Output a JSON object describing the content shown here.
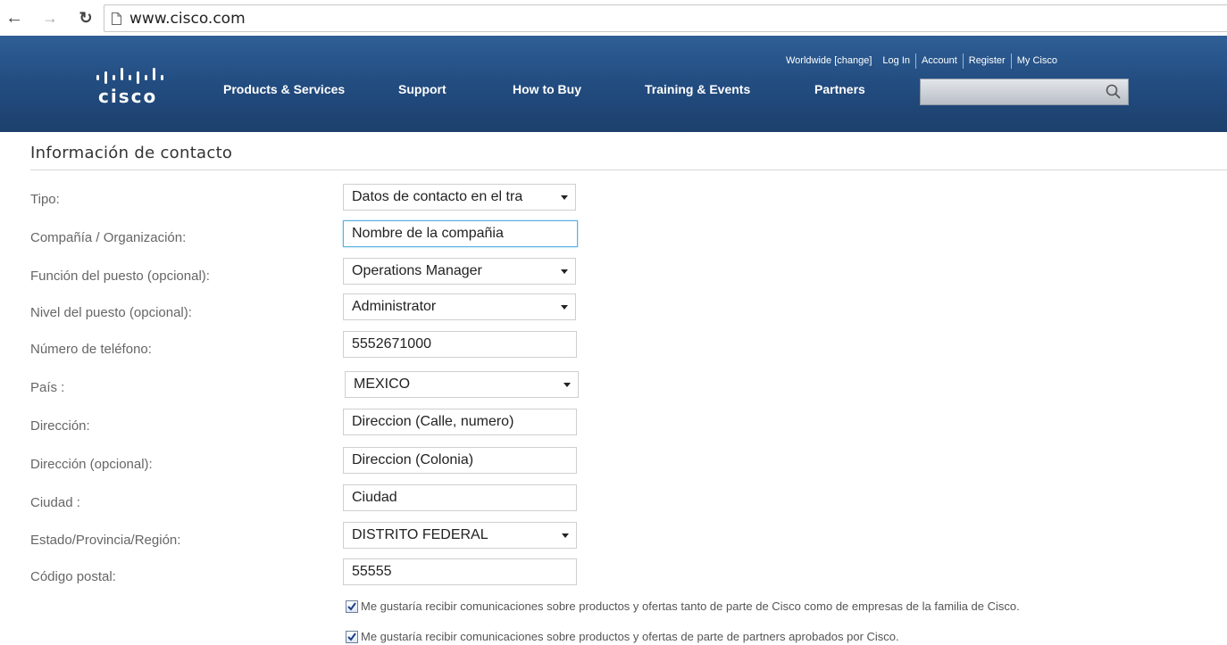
{
  "browser": {
    "url": "www.cisco.com"
  },
  "header": {
    "logo_text": "cisco",
    "util_links": [
      "Worldwide [change]",
      "Log In",
      "Account",
      "Register",
      "My Cisco"
    ],
    "nav": [
      "Products & Services",
      "Support",
      "How to Buy",
      "Training & Events",
      "Partners"
    ],
    "search": {
      "value": ""
    }
  },
  "section": {
    "title": "Información de contacto"
  },
  "form": {
    "fields": [
      {
        "label": "Tipo:",
        "type": "select",
        "value": "Datos de contacto en el tra"
      },
      {
        "label": "Compañía / Organización:",
        "type": "text",
        "value": "Nombre de la compañia"
      },
      {
        "label": "Función del puesto (opcional):",
        "type": "select",
        "value": "Operations Manager"
      },
      {
        "label": "Nivel del puesto (opcional):",
        "type": "select",
        "value": "Administrator"
      },
      {
        "label": "Número de teléfono:",
        "type": "text",
        "value": "5552671000"
      },
      {
        "label": "País :",
        "type": "select",
        "value": "MEXICO"
      },
      {
        "label": "Dirección:",
        "type": "text",
        "value": "Direccion (Calle, numero)"
      },
      {
        "label": "Dirección (opcional):",
        "type": "text",
        "value": "Direccion (Colonia)"
      },
      {
        "label": "Ciudad :",
        "type": "text",
        "value": "Ciudad"
      },
      {
        "label": "Estado/Provincia/Región:",
        "type": "select",
        "value": "DISTRITO FEDERAL"
      },
      {
        "label": "Código postal:",
        "type": "text",
        "value": "55555"
      }
    ],
    "checkboxes": [
      {
        "checked": true,
        "label": "Me gustaría recibir comunicaciones sobre productos y ofertas tanto de parte de Cisco como de empresas de la familia de Cisco."
      },
      {
        "checked": true,
        "label": "Me gustaría recibir comunicaciones sobre productos y ofertas de parte de partners aprobados por Cisco."
      }
    ]
  },
  "colors": {
    "header_blue": "#234e82",
    "focus_border": "#5bb0e0"
  }
}
